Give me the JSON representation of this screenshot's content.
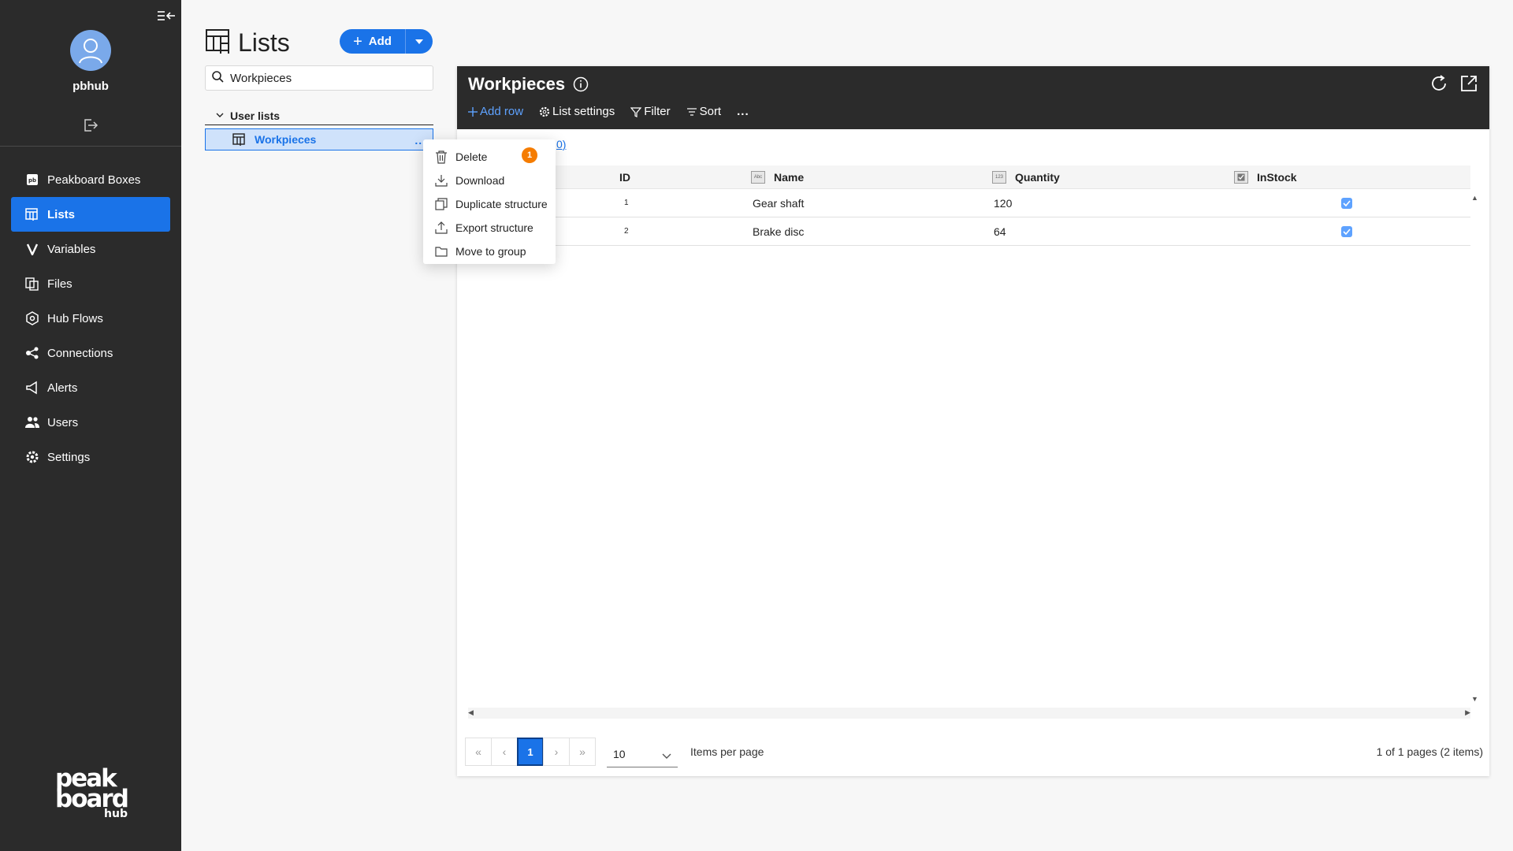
{
  "sidebar": {
    "username": "pbhub",
    "items": [
      {
        "label": "Peakboard Boxes",
        "icon": "pb-box-icon"
      },
      {
        "label": "Lists",
        "icon": "lists-icon",
        "active": true
      },
      {
        "label": "Variables",
        "icon": "variables-icon"
      },
      {
        "label": "Files",
        "icon": "files-icon"
      },
      {
        "label": "Hub Flows",
        "icon": "hub-flows-icon"
      },
      {
        "label": "Connections",
        "icon": "connections-icon"
      },
      {
        "label": "Alerts",
        "icon": "alerts-icon"
      },
      {
        "label": "Users",
        "icon": "users-icon"
      },
      {
        "label": "Settings",
        "icon": "settings-icon"
      }
    ],
    "brand_top": "peak",
    "brand_mid": "board",
    "brand_sub": "hub"
  },
  "lists_panel": {
    "title": "Lists",
    "add_label": "Add",
    "search_value": "Workpieces",
    "group_label": "User lists",
    "selected_list": "Workpieces",
    "more_label": "..."
  },
  "context_menu": {
    "items": [
      {
        "label": "Delete",
        "icon": "trash-icon"
      },
      {
        "label": "Download",
        "icon": "download-icon"
      },
      {
        "label": "Duplicate structure",
        "icon": "duplicate-icon"
      },
      {
        "label": "Export structure",
        "icon": "export-icon"
      },
      {
        "label": "Move to group",
        "icon": "folder-icon"
      }
    ],
    "badge": "1"
  },
  "card": {
    "title": "Workpieces",
    "toolbar": {
      "add_row": "Add row",
      "list_settings": "List settings",
      "filter": "Filter",
      "sort": "Sort",
      "more": "..."
    },
    "partial_link": "0)"
  },
  "table": {
    "columns": [
      {
        "label": "ID",
        "type_badge": ""
      },
      {
        "label": "Name",
        "type_badge": "Abc"
      },
      {
        "label": "Quantity",
        "type_badge": "123"
      },
      {
        "label": "InStock",
        "type_badge": "check"
      }
    ],
    "rows": [
      {
        "id": "1",
        "name": "Gear shaft",
        "quantity": "120",
        "instock": true
      },
      {
        "id": "2",
        "name": "Brake disc",
        "quantity": "64",
        "instock": true
      }
    ]
  },
  "pagination": {
    "current_page": "1",
    "page_size": "10",
    "items_per_page_label": "Items per page",
    "info": "1 of 1 pages (2 items)"
  },
  "colors": {
    "accent": "#1a73e8",
    "sidebar_bg": "#2b2b2b",
    "badge": "#f57c00"
  }
}
